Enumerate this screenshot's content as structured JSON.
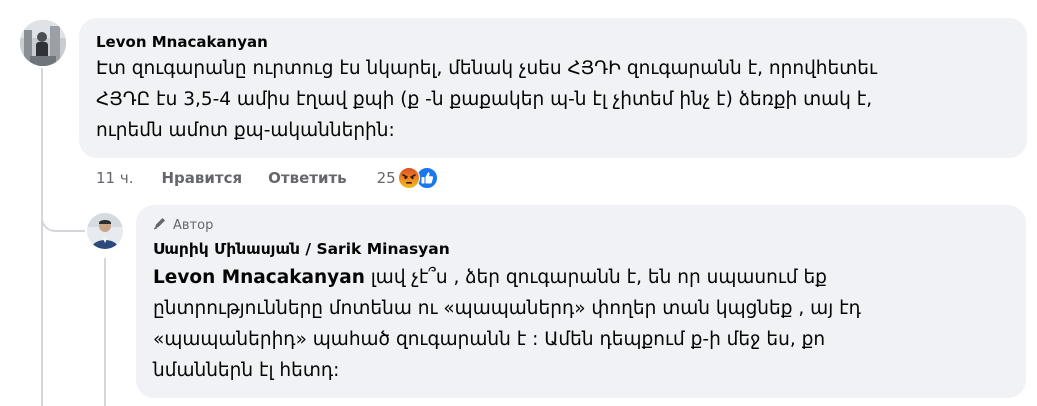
{
  "comment": {
    "author": "Levon Mnacakanyan",
    "lines": [
      "Էտ զուգարանը ուրտուց էս նկարել, մենակ չսես ՀՅԴԻ զուգարանն է, որովհետեւ",
      "ՀՅԴԸ էս 3,5-4 ամիս էղավ քպի (ք -ն քաքակեր պ-ն էլ չիտեմ ինչ է) ձեռքի տակ է,",
      "ուրեմն ամոտ քպ-ականներին:"
    ],
    "time": "11 ч.",
    "like_label": "Нравится",
    "reply_label": "Ответить",
    "reaction_count": "25",
    "reactions": [
      "angry-icon",
      "like-icon"
    ],
    "colors": {
      "angry": "#e9710f",
      "like": "#1877f2"
    }
  },
  "reply": {
    "badge": "Автор",
    "badge_icon": "pen-icon",
    "author_native": "Սարիկ Մինասյան",
    "author_sep": " / ",
    "author_latin": "Sarik Minasyan",
    "mention": "Levon Mnacakanyan",
    "first_line_rest": " լավ չէ՞ս , ձեր զուգարանն է, են որ սպասում եք",
    "lines": [
      "ընտրությունները մոտենա ու «պապաներդ» փողեր տան կպցնեք , այ էդ",
      "«պապաներիդ» պահած զուգարանն է : Ամեն դեպքում ք-ի մեջ ես, քո",
      "նմաններն էլ հետդ:"
    ]
  }
}
